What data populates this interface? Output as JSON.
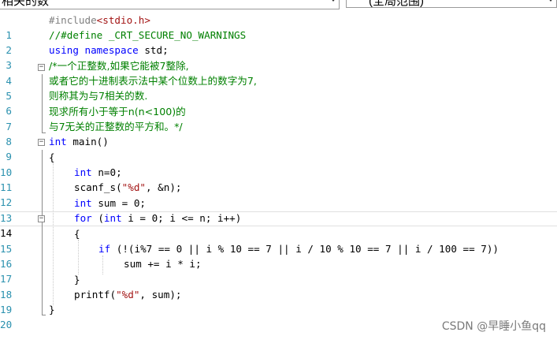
{
  "toolbar": {
    "function_dropdown": "相关的数",
    "scope_dropdown": "(全局范围)"
  },
  "editor": {
    "current_line": "14",
    "lines": [
      {
        "num": "1"
      },
      {
        "num": "2"
      },
      {
        "num": "3"
      },
      {
        "num": "4"
      },
      {
        "num": "5"
      },
      {
        "num": "6"
      },
      {
        "num": "7"
      },
      {
        "num": "8"
      },
      {
        "num": "9"
      },
      {
        "num": "10"
      },
      {
        "num": "11"
      },
      {
        "num": "12"
      },
      {
        "num": "13"
      },
      {
        "num": "14"
      },
      {
        "num": "15"
      },
      {
        "num": "16"
      },
      {
        "num": "17"
      },
      {
        "num": "18"
      },
      {
        "num": "19"
      },
      {
        "num": "20"
      }
    ],
    "code": {
      "l1_pp": "#include",
      "l1_hdr": "<stdio.h>",
      "l2": "//#define _CRT_SECURE_NO_WARNINGS",
      "l3_kw1": "using",
      "l3_kw2": "namespace",
      "l3_rest": " std;",
      "l4": "/*一个正整数,如果它能被7整除,",
      "l5": "或者它的十进制表示法中某个位数上的数字为7,",
      "l6": "则称其为与7相关的数.",
      "l7": "现求所有小于等于n(n<100)的",
      "l8": "与7无关的正整数的平方和。*/",
      "l9_kw": "int",
      "l9_rest": " main()",
      "l10": "{",
      "l11_kw": "int",
      "l11_rest": " n=0;",
      "l12_a": "scanf_s(",
      "l12_str": "\"%d\"",
      "l12_b": ", &n);",
      "l13_kw": "int",
      "l13_rest": " sum = 0;",
      "l14_kw1": "for",
      "l14_a": " (",
      "l14_kw2": "int",
      "l14_b": " i = 0; i <= n; i++)",
      "l15": "{",
      "l16_kw": "if",
      "l16_rest": " (!(i%7 == 0 || i % 10 == 7 || i / 10 % 10 == 7 || i / 100 == 7))",
      "l17": "sum += i * i;",
      "l18": "}",
      "l19_a": "printf(",
      "l19_str": "\"%d\"",
      "l19_b": ", sum);",
      "l20": "}"
    }
  },
  "watermark": "CSDN @早睡小鱼qq",
  "colors": {
    "keyword": "#0000ff",
    "comment": "#008000",
    "string": "#a31515",
    "preprocessor": "#808080",
    "line_number": "#2b91af"
  }
}
